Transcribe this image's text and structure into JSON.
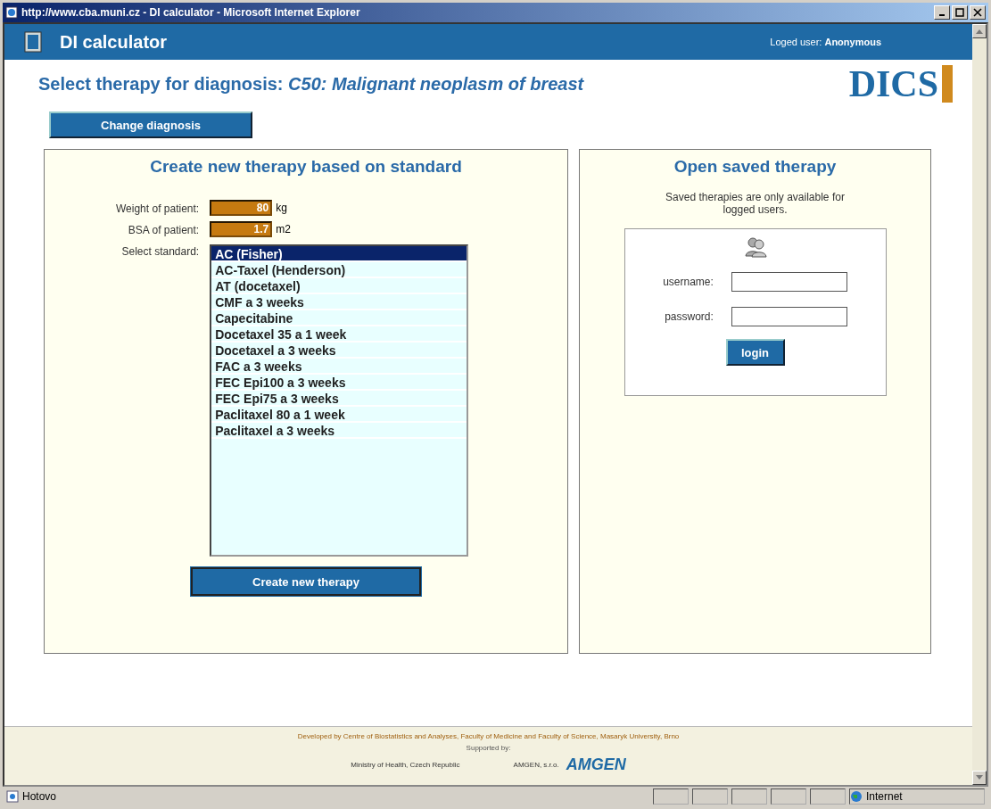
{
  "window": {
    "title": "http://www.cba.muni.cz - DI calculator - Microsoft Internet Explorer"
  },
  "header": {
    "app_title": "DI calculator",
    "user_label": "Loged user:",
    "user_name": "Anonymous",
    "logo": "DICS"
  },
  "heading": {
    "label": "Select therapy for diagnosis:",
    "diagnosis": "C50: Malignant neoplasm of breast"
  },
  "change_button": "Change diagnosis",
  "new_therapy": {
    "title": "Create new therapy based on standard",
    "fields": [
      {
        "label": "Weight of patient:",
        "value": "80",
        "unit": "kg"
      },
      {
        "label": "BSA of patient:",
        "value": "1.7",
        "unit": "m2"
      }
    ],
    "standard_label": "Select standard:",
    "standards": [
      {
        "label": "AC (Fisher)",
        "selected": true
      },
      {
        "label": "AC-Taxel (Henderson)",
        "selected": false
      },
      {
        "label": "AT (docetaxel)",
        "selected": false
      },
      {
        "label": "CMF a 3 weeks",
        "selected": false
      },
      {
        "label": "Capecitabine",
        "selected": false
      },
      {
        "label": "Docetaxel 35 a 1 week",
        "selected": false
      },
      {
        "label": "Docetaxel a 3 weeks",
        "selected": false
      },
      {
        "label": "FAC a 3 weeks",
        "selected": false
      },
      {
        "label": "FEC Epi100 a 3 weeks",
        "selected": false
      },
      {
        "label": "FEC Epi75 a 3 weeks",
        "selected": false
      },
      {
        "label": "Paclitaxel 80 a 1 week",
        "selected": false
      },
      {
        "label": "Paclitaxel a 3 weeks",
        "selected": false
      }
    ],
    "button": "Create new therapy"
  },
  "saved_therapy": {
    "title": "Open saved therapy",
    "note": "Saved therapies are only available for logged users.",
    "username_label": "username:",
    "password_label": "password:",
    "button": "login"
  },
  "footer": {
    "developed": "Developed by Centre of Biostatistics and Analyses, Faculty of Medicine and Faculty of Science, Masaryk University, Brno",
    "supported": "Supported by:",
    "sponsors": [
      "Ministry of Health, Czech Republic",
      "AMGEN, s.r.o."
    ],
    "logo": "AMGEN"
  },
  "status_bar": {
    "text": "Hotovo",
    "zone": "Internet"
  }
}
